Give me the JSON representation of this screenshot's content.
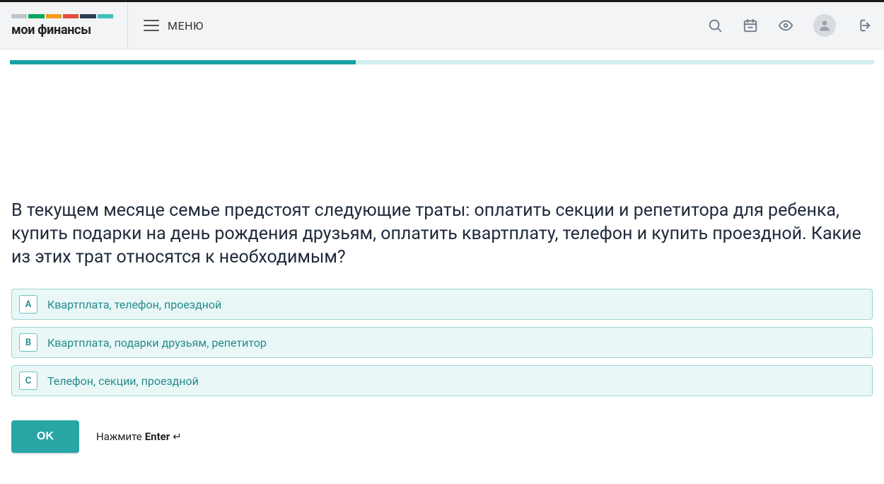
{
  "header": {
    "logo_text": "мои финансы",
    "menu_label": "МЕНЮ"
  },
  "progress": {
    "percent": 40
  },
  "quiz": {
    "question": "В текущем месяце семье предстоят следующие траты: оплатить секции и репетитора для ребенка, купить подарки на день рождения друзьям, оплатить квартплату, телефон и купить проездной. Какие из этих трат относятся к необходимым?",
    "options": [
      {
        "key": "A",
        "text": "Квартплата, телефон, проездной"
      },
      {
        "key": "B",
        "text": "Квартплата, подарки друзьям, репетитор"
      },
      {
        "key": "C",
        "text": "Телефон, секции, проездной"
      }
    ],
    "ok_label": "OK",
    "hint_prefix": "Нажмите ",
    "hint_key": "Enter",
    "hint_arrow": "↵"
  }
}
